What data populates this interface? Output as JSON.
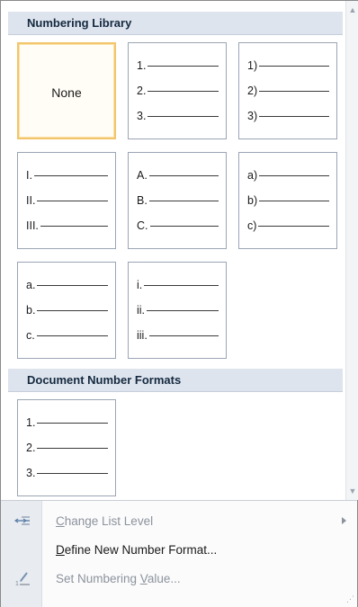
{
  "sections": {
    "library": {
      "title": "Numbering Library",
      "tiles": [
        {
          "name": "none",
          "label": "None",
          "selected": true,
          "markers": []
        },
        {
          "name": "arabic-period",
          "markers": [
            "1.",
            "2.",
            "3."
          ]
        },
        {
          "name": "arabic-paren",
          "markers": [
            "1)",
            "2)",
            "3)"
          ]
        },
        {
          "name": "roman-upper",
          "markers": [
            "I.",
            "II.",
            "III."
          ]
        },
        {
          "name": "alpha-upper",
          "markers": [
            "A.",
            "B.",
            "C."
          ]
        },
        {
          "name": "alpha-lower-paren",
          "markers": [
            "a)",
            "b)",
            "c)"
          ]
        },
        {
          "name": "alpha-lower-period",
          "markers": [
            "a.",
            "b.",
            "c."
          ]
        },
        {
          "name": "roman-lower",
          "markers": [
            "i.",
            "ii.",
            "iii."
          ]
        }
      ]
    },
    "document": {
      "title": "Document Number Formats",
      "tiles": [
        {
          "name": "doc-arabic-period",
          "markers": [
            "1.",
            "2.",
            "3."
          ]
        }
      ]
    }
  },
  "menu": {
    "items": [
      {
        "name": "change-list-level",
        "label": "Change List Level",
        "mnemonic": "C",
        "disabled": true,
        "submenu": true,
        "icon": "change-list-level-icon"
      },
      {
        "name": "define-new-number-format",
        "label": "Define New Number Format...",
        "mnemonic": "D",
        "disabled": false,
        "submenu": false,
        "icon": ""
      },
      {
        "name": "set-numbering-value",
        "label": "Set Numbering Value...",
        "mnemonic": "V",
        "disabled": true,
        "submenu": false,
        "icon": "set-numbering-value-icon"
      }
    ]
  },
  "scrollbar": {
    "up_arrow": "▲",
    "down_arrow": "▼"
  },
  "resize_grip": "⋰",
  "colors": {
    "header_bg": "#dde4ee",
    "selected_border": "#f3c56c",
    "disabled_text": "#8c939c"
  }
}
